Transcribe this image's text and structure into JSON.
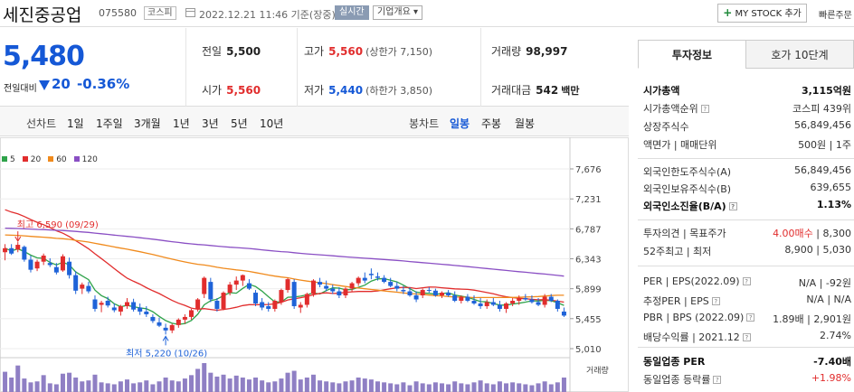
{
  "header": {
    "stock_name": "세진중공업",
    "stock_code": "075580",
    "market": "코스피",
    "datetime": "2022.12.21 11:46 기준(장중)",
    "realtime_label": "실시간",
    "company_label": "기업개요 ▾",
    "mystock_label": "MY STOCK 추가",
    "quick_order_label": "빠른주문"
  },
  "price": {
    "current": "5,480",
    "change_label": "전일대비",
    "change_value": "20",
    "change_rate": "-0.36%"
  },
  "summary": {
    "prev_close_label": "전일",
    "prev_close": "5,500",
    "high_label": "고가",
    "high": "5,560",
    "upper_limit": "(상한가 7,150)",
    "volume_label": "거래량",
    "volume": "98,997",
    "open_label": "시가",
    "open": "5,560",
    "low_label": "저가",
    "low": "5,440",
    "lower_limit": "(하한가 3,850)",
    "amount_label": "거래대금",
    "amount": "542",
    "amount_unit": "백만"
  },
  "toolbar": {
    "line_label": "선차트",
    "line_periods": [
      "1일",
      "1주일",
      "3개월",
      "1년",
      "3년",
      "5년",
      "10년"
    ],
    "candle_label": "봉차트",
    "candle_periods": [
      "일봉",
      "주봉",
      "월봉"
    ],
    "active_candle": "일봉"
  },
  "chart_data": {
    "type": "candlestick",
    "title": "",
    "legend": [
      {
        "name": "5",
        "color": "#2fa34a"
      },
      {
        "name": "20",
        "color": "#e12d2d"
      },
      {
        "name": "60",
        "color": "#f08a1c"
      },
      {
        "name": "120",
        "color": "#8a4fc4"
      }
    ],
    "y_ticks": [
      7676,
      7231,
      6787,
      6343,
      5899,
      5455,
      5010
    ],
    "y_tick_labels": [
      "7,676",
      "7,231",
      "6,787",
      "6,343",
      "5,899",
      "5,455",
      "5,010"
    ],
    "ylim": [
      5010,
      7676
    ],
    "volume_label": "거래량",
    "max_annotation": "최고 6,590 (09/29)",
    "min_annotation": "최저 5,220 (10/26)",
    "max_index": 2,
    "min_index": 25,
    "candles": [
      [
        6440,
        6560,
        6320,
        6500
      ],
      [
        6500,
        6560,
        6400,
        6420
      ],
      [
        6480,
        6590,
        6440,
        6550
      ],
      [
        6520,
        6540,
        6300,
        6330
      ],
      [
        6330,
        6390,
        6140,
        6180
      ],
      [
        6200,
        6330,
        6160,
        6300
      ],
      [
        6300,
        6420,
        6250,
        6390
      ],
      [
        6280,
        6350,
        6220,
        6250
      ],
      [
        6220,
        6280,
        6110,
        6140
      ],
      [
        6170,
        6410,
        6150,
        6380
      ],
      [
        6300,
        6360,
        6050,
        6100
      ],
      [
        6100,
        6160,
        5820,
        5870
      ],
      [
        5900,
        5990,
        5820,
        5960
      ],
      [
        5940,
        6000,
        5830,
        5860
      ],
      [
        5740,
        5800,
        5560,
        5600
      ],
      [
        5660,
        5720,
        5550,
        5690
      ],
      [
        5720,
        5780,
        5620,
        5650
      ],
      [
        5620,
        5680,
        5550,
        5580
      ],
      [
        5560,
        5660,
        5500,
        5640
      ],
      [
        5640,
        5760,
        5600,
        5700
      ],
      [
        5700,
        5750,
        5560,
        5590
      ],
      [
        5620,
        5680,
        5510,
        5560
      ],
      [
        5560,
        5640,
        5480,
        5520
      ],
      [
        5480,
        5520,
        5390,
        5420
      ],
      [
        5400,
        5470,
        5330,
        5350
      ],
      [
        5320,
        5380,
        5220,
        5280
      ],
      [
        5280,
        5380,
        5240,
        5360
      ],
      [
        5360,
        5460,
        5320,
        5440
      ],
      [
        5440,
        5520,
        5380,
        5480
      ],
      [
        5480,
        5600,
        5440,
        5580
      ],
      [
        5600,
        5760,
        5560,
        5740
      ],
      [
        5820,
        6080,
        5760,
        6060
      ],
      [
        6000,
        6060,
        5700,
        5740
      ],
      [
        5720,
        5760,
        5560,
        5600
      ],
      [
        5600,
        5860,
        5580,
        5840
      ],
      [
        5840,
        6000,
        5800,
        5960
      ],
      [
        5960,
        6080,
        5880,
        6020
      ],
      [
        6020,
        6110,
        5940,
        6100
      ],
      [
        5980,
        6040,
        5880,
        5900
      ],
      [
        5840,
        5880,
        5640,
        5680
      ],
      [
        5700,
        5760,
        5580,
        5620
      ],
      [
        5640,
        5700,
        5560,
        5600
      ],
      [
        5600,
        5740,
        5560,
        5720
      ],
      [
        5700,
        5900,
        5660,
        5880
      ],
      [
        5880,
        6060,
        5840,
        6040
      ],
      [
        6000,
        6040,
        5600,
        5640
      ],
      [
        5620,
        5700,
        5540,
        5660
      ],
      [
        5660,
        5840,
        5620,
        5820
      ],
      [
        5820,
        6040,
        5780,
        6020
      ],
      [
        6000,
        6060,
        5920,
        5960
      ],
      [
        5940,
        6020,
        5860,
        5900
      ],
      [
        5900,
        5960,
        5820,
        5860
      ],
      [
        5860,
        5920,
        5760,
        5800
      ],
      [
        5800,
        5920,
        5760,
        5900
      ],
      [
        5900,
        6000,
        5860,
        5980
      ],
      [
        5980,
        6080,
        5940,
        6060
      ],
      [
        6060,
        6140,
        5980,
        6020
      ],
      [
        6120,
        6200,
        6040,
        6100
      ],
      [
        6080,
        6140,
        6020,
        6060
      ],
      [
        6060,
        6100,
        5980,
        6000
      ],
      [
        6000,
        6060,
        5920,
        5940
      ],
      [
        5940,
        6000,
        5860,
        5900
      ],
      [
        5880,
        5940,
        5820,
        5860
      ],
      [
        5860,
        5920,
        5780,
        5800
      ],
      [
        5800,
        5860,
        5700,
        5740
      ],
      [
        5800,
        5900,
        5760,
        5880
      ],
      [
        5880,
        5920,
        5840,
        5870
      ],
      [
        5870,
        5900,
        5780,
        5800
      ],
      [
        5800,
        5860,
        5760,
        5840
      ],
      [
        5840,
        5880,
        5780,
        5800
      ],
      [
        5800,
        5860,
        5700,
        5720
      ],
      [
        5720,
        5800,
        5680,
        5780
      ],
      [
        5780,
        5820,
        5700,
        5720
      ],
      [
        5720,
        5800,
        5660,
        5680
      ],
      [
        5680,
        5760,
        5600,
        5640
      ],
      [
        5640,
        5740,
        5600,
        5700
      ],
      [
        5700,
        5760,
        5640,
        5660
      ],
      [
        5660,
        5720,
        5560,
        5600
      ],
      [
        5600,
        5700,
        5540,
        5680
      ],
      [
        5680,
        5760,
        5640,
        5720
      ],
      [
        5720,
        5800,
        5660,
        5760
      ],
      [
        5760,
        5820,
        5720,
        5740
      ],
      [
        5740,
        5800,
        5680,
        5700
      ],
      [
        5700,
        5760,
        5640,
        5660
      ],
      [
        5660,
        5820,
        5620,
        5780
      ],
      [
        5780,
        5820,
        5700,
        5720
      ],
      [
        5720,
        5740,
        5560,
        5600
      ],
      [
        5560,
        5620,
        5480,
        5500
      ]
    ],
    "volumes": [
      42,
      30,
      55,
      28,
      20,
      22,
      35,
      18,
      16,
      38,
      40,
      30,
      22,
      24,
      36,
      20,
      18,
      16,
      22,
      26,
      18,
      20,
      24,
      16,
      22,
      30,
      24,
      22,
      28,
      35,
      48,
      60,
      40,
      32,
      36,
      28,
      34,
      30,
      26,
      30,
      24,
      20,
      22,
      28,
      40,
      44,
      26,
      30,
      36,
      24,
      22,
      20,
      18,
      22,
      24,
      30,
      28,
      26,
      22,
      20,
      18,
      16,
      20,
      14,
      22,
      18,
      16,
      20,
      18,
      16,
      22,
      18,
      16,
      20,
      24,
      18,
      16,
      22,
      18,
      20,
      18,
      16,
      14,
      18,
      22,
      16,
      20,
      30
    ]
  },
  "side": {
    "tabs": [
      "투자정보",
      "호가 10단계"
    ],
    "rows": [
      {
        "k": "시가총액",
        "v": "3,115억원",
        "bold": true
      },
      {
        "k": "시가총액순위",
        "v": "코스피 439위"
      },
      {
        "k": "상장주식수",
        "v": "56,849,456"
      },
      {
        "k": "액면가 | 매매단위",
        "v": "500원 | 1주"
      },
      {
        "k": "외국인한도주식수(A)",
        "v": "56,849,456"
      },
      {
        "k": "외국인보유주식수(B)",
        "v": "639,655"
      },
      {
        "k": "외국인소진율(B/A)",
        "v": "1.13%",
        "bold": true
      },
      {
        "k": "투자의견 | 목표주가",
        "v_red": "4.00매수",
        "v": " | 8,300"
      },
      {
        "k": "52주최고 | 최저",
        "v": "8,900 | 5,030"
      },
      {
        "k": "PER | EPS(2022.09)",
        "v": "N/A | -92원"
      },
      {
        "k": "추정PER | EPS",
        "v": "N/A | N/A"
      },
      {
        "k": "PBR | BPS (2022.09)",
        "v": "1.89배 | 2,901원"
      },
      {
        "k": "배당수익률 | 2021.12",
        "v": "2.74%"
      },
      {
        "k": "동일업종 PER",
        "v": "-7.40배",
        "bold": true
      },
      {
        "k": "동일업종 등락률",
        "v": "+1.98%",
        "red": true
      }
    ]
  }
}
